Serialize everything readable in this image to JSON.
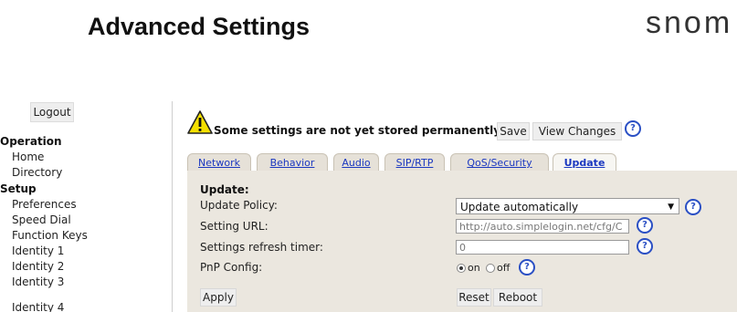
{
  "header": {
    "title": "Advanced Settings",
    "logo_text": "snom"
  },
  "sidebar": {
    "logout_label": "Logout",
    "groups": [
      {
        "label": "Operation",
        "items": [
          "Home",
          "Directory"
        ]
      },
      {
        "label": "Setup",
        "items": [
          "Preferences",
          "Speed Dial",
          "Function Keys",
          "Identity 1",
          "Identity 2",
          "Identity 3",
          "Identity 4"
        ]
      }
    ]
  },
  "warning": {
    "text": "Some settings are not yet stored permanently.",
    "save_label": "Save",
    "view_changes_label": "View Changes"
  },
  "tabs": [
    "Network",
    "Behavior",
    "Audio",
    "SIP/RTP",
    "QoS/Security",
    "Update"
  ],
  "active_tab": "Update",
  "panel": {
    "section_title": "Update:",
    "fields": {
      "update_policy_label": "Update Policy:",
      "update_policy_value": "Update automatically",
      "setting_url_label": "Setting URL:",
      "setting_url_value": "http://auto.simplelogin.net/cfg/C",
      "refresh_timer_label": "Settings refresh timer:",
      "refresh_timer_value": "0",
      "pnp_label": "PnP Config:",
      "pnp_on_label": "on",
      "pnp_off_label": "off",
      "pnp_selected": "on"
    },
    "apply_label": "Apply",
    "reset_label": "Reset",
    "reboot_label": "Reboot",
    "help_symbol": "?"
  },
  "colors": {
    "link": "#1a37c0",
    "panel_bg": "#ebe7df",
    "help_icon": "#2a4fc4"
  }
}
